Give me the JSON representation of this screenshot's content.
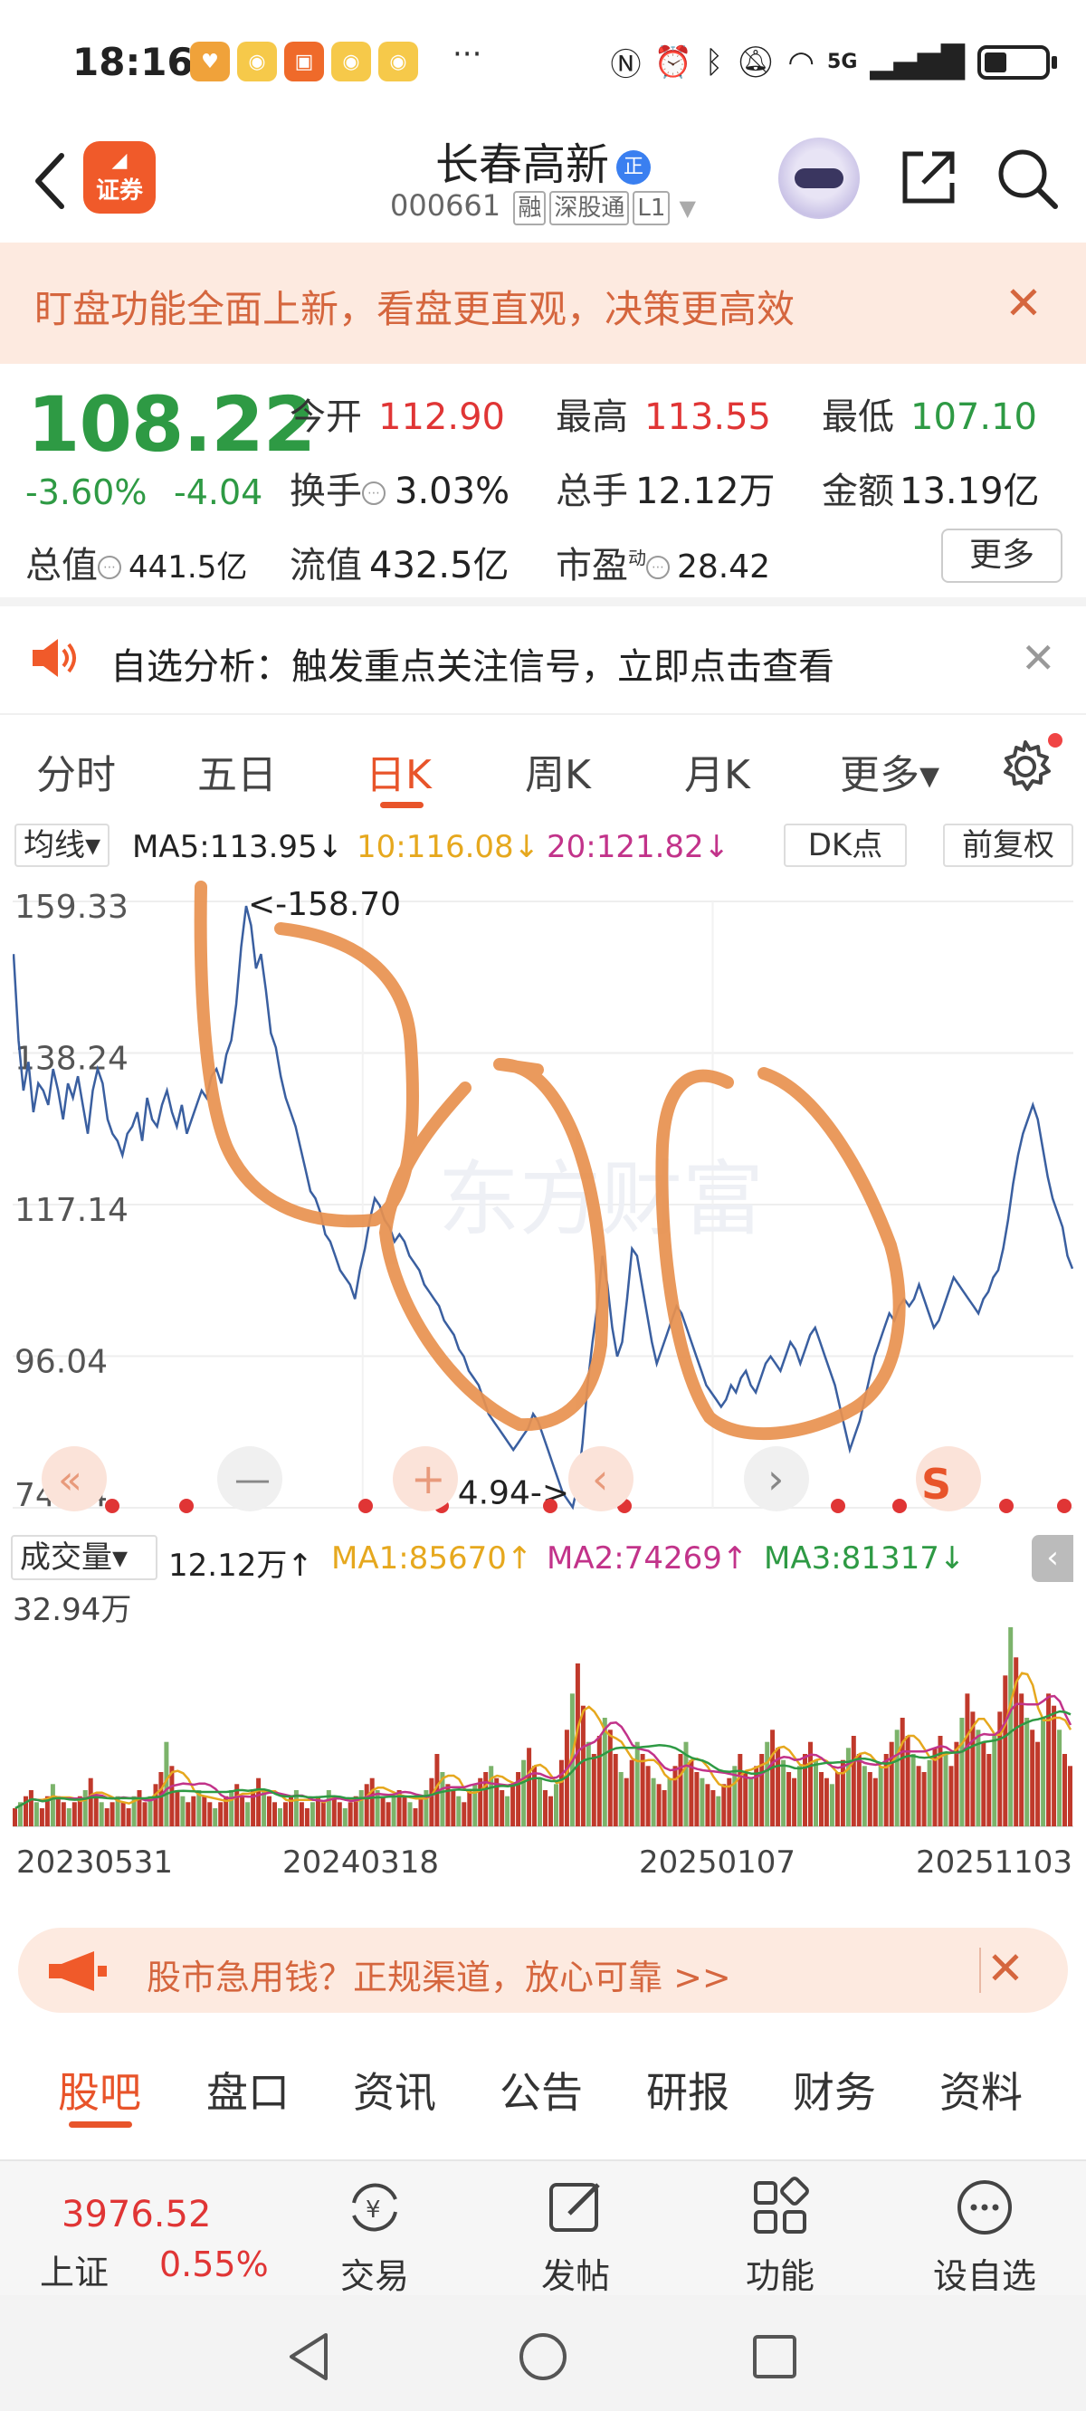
{
  "status_bar": {
    "time": "18:16",
    "dots": "···",
    "network": "5G"
  },
  "header": {
    "back": "back",
    "logo_text": "证券",
    "stock_name": "长春高新",
    "name_badge": "正",
    "code": "000661",
    "tags": [
      "融",
      "深股通",
      "L1"
    ]
  },
  "banner": {
    "text": "盯盘功能全面上新，看盘更直观，决策更高效",
    "close": "✕"
  },
  "quote": {
    "price": "108.22",
    "change_pct": "-3.60%",
    "change_amt": "-4.04",
    "open_label": "今开",
    "open": "112.90",
    "high_label": "最高",
    "high": "113.55",
    "low_label": "最低",
    "low": "107.10",
    "turnover_label": "换手",
    "turnover": "3.03%",
    "volume_label": "总手",
    "volume": "12.12万",
    "amount_label": "金额",
    "amount": "13.19亿",
    "mktcap_label": "总值",
    "mktcap": "441.5亿",
    "float_label": "流值",
    "float_cap": "432.5亿",
    "pe_label": "市盈",
    "pe_sup": "动",
    "pe": "28.42",
    "more": "更多"
  },
  "notice": {
    "text": "自选分析：触发重点关注信号，立即点击查看",
    "close": "✕"
  },
  "ktabs": [
    "分时",
    "五日",
    "日K",
    "周K",
    "月K",
    "更多▾"
  ],
  "ma_row": {
    "selector": "均线▾",
    "ma5": "MA5:113.95↓",
    "ma10": "10:116.08↓",
    "ma20": "20:121.82↓",
    "dk": "DK点",
    "fq": "前复权"
  },
  "chart_data": {
    "type": "line",
    "y_ticks": [
      "159.33",
      "138.24",
      "117.14",
      "96.04",
      "74.94"
    ],
    "ylim": [
      74.94,
      159.33
    ],
    "annotations": [
      "<-158.70",
      "74.94->"
    ],
    "x_labels": [
      "20230531",
      "20240318",
      "20250107",
      "20251103"
    ],
    "series": [
      {
        "values": [
          152,
          140,
          133,
          137,
          130,
          134,
          133,
          131,
          136,
          133,
          129,
          134,
          132,
          135,
          131,
          127,
          133,
          136,
          134,
          129,
          127,
          126,
          124,
          127,
          128,
          130,
          126,
          132,
          129,
          128,
          131,
          133,
          130,
          128,
          131,
          127,
          129,
          131,
          133,
          132,
          135,
          136,
          134,
          138,
          140,
          145,
          153,
          158.7,
          156,
          150,
          152,
          147,
          141,
          139,
          135,
          132,
          130,
          128,
          125,
          122,
          119,
          118,
          116,
          113,
          112,
          110,
          108,
          107,
          106,
          104,
          108,
          111,
          115,
          118,
          117,
          115,
          114,
          112,
          113,
          112,
          110,
          109,
          108,
          106,
          105,
          104,
          103,
          101,
          100,
          99,
          97,
          96,
          94,
          93,
          92,
          90,
          88,
          87,
          86,
          85,
          84,
          83,
          84,
          85,
          86,
          88,
          87,
          85,
          83,
          81,
          79,
          77,
          76,
          75,
          78,
          84,
          92,
          98,
          103,
          110,
          106,
          100,
          96,
          98,
          104,
          111,
          110,
          106,
          102,
          98,
          95,
          97,
          99,
          101,
          103,
          102,
          100,
          98,
          96,
          94,
          92,
          91,
          90,
          89,
          90,
          92,
          91,
          93,
          94,
          92,
          91,
          93,
          95,
          96,
          95,
          94,
          96,
          98,
          97,
          95,
          97,
          99,
          100,
          98,
          96,
          94,
          92,
          89,
          86,
          83,
          85,
          87,
          90,
          93,
          96,
          98,
          100,
          102,
          101,
          103,
          104,
          103,
          104,
          106,
          104,
          102,
          100,
          101,
          103,
          105,
          107,
          106,
          105,
          104,
          103,
          102,
          104,
          105,
          107,
          108,
          111,
          115,
          120,
          124,
          127,
          129,
          131,
          129,
          125,
          121,
          118,
          116,
          114,
          110,
          108.22
        ]
      }
    ]
  },
  "chart_nav": [
    "«",
    "—",
    "+",
    "‹",
    "›",
    "S"
  ],
  "volume_row": {
    "selector": "成交量▾",
    "total": "12.12万↑",
    "ma1": "MA1:85670↑",
    "ma2": "MA2:74269↑",
    "ma3": "MA3:81317↓",
    "max_label": "32.94万"
  },
  "volume_data": {
    "values": [
      3,
      4,
      5,
      6,
      4,
      3,
      5,
      7,
      5,
      4,
      3,
      4,
      5,
      6,
      8,
      5,
      4,
      3,
      4,
      5,
      4,
      3,
      5,
      6,
      4,
      5,
      7,
      9,
      14,
      10,
      6,
      5,
      4,
      5,
      6,
      5,
      4,
      3,
      4,
      5,
      6,
      7,
      5,
      4,
      6,
      8,
      6,
      5,
      4,
      3,
      4,
      5,
      6,
      4,
      3,
      4,
      5,
      4,
      6,
      5,
      4,
      3,
      4,
      5,
      6,
      7,
      8,
      6,
      5,
      4,
      5,
      6,
      5,
      4,
      3,
      5,
      6,
      8,
      12,
      9,
      7,
      6,
      5,
      4,
      6,
      7,
      8,
      9,
      10,
      8,
      6,
      5,
      7,
      9,
      11,
      13,
      10,
      8,
      6,
      5,
      7,
      11,
      16,
      22,
      27,
      20,
      14,
      12,
      15,
      18,
      16,
      12,
      9,
      8,
      11,
      14,
      12,
      10,
      8,
      7,
      6,
      8,
      10,
      12,
      14,
      11,
      9,
      8,
      7,
      6,
      5,
      7,
      8,
      10,
      12,
      9,
      8,
      10,
      12,
      14,
      16,
      13,
      11,
      9,
      8,
      10,
      12,
      14,
      11,
      9,
      8,
      7,
      9,
      11,
      13,
      15,
      12,
      10,
      9,
      8,
      10,
      12,
      14,
      16,
      18,
      15,
      12,
      10,
      9,
      11,
      13,
      15,
      12,
      10,
      14,
      18,
      22,
      19,
      16,
      14,
      12,
      15,
      19,
      25,
      33,
      28,
      22,
      18,
      16,
      14,
      18,
      22,
      20,
      16,
      12,
      10
    ]
  },
  "bottom_promo": {
    "text": "股市急用钱？正规渠道，放心可靠 >>",
    "close": "✕"
  },
  "bottom_tabs": [
    "股吧",
    "盘口",
    "资讯",
    "公告",
    "研报",
    "财务",
    "资料"
  ],
  "bottom_nav": {
    "index_value": "3976.52",
    "index_name": "上证",
    "index_change": "0.55%",
    "items": [
      "交易",
      "发帖",
      "功能",
      "设自选"
    ]
  },
  "colors": {
    "accent": "#e8542a",
    "up": "#e03535",
    "down": "#2e9a44",
    "price_line": "#3a5fa0",
    "annotation": "#e8914f"
  }
}
